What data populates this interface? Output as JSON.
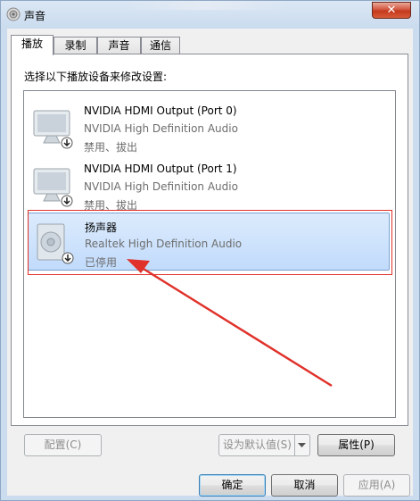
{
  "window": {
    "title": "声音",
    "close_symbol": "✕"
  },
  "tabs": [
    {
      "label": "播放",
      "active": true
    },
    {
      "label": "录制",
      "active": false
    },
    {
      "label": "声音",
      "active": false
    },
    {
      "label": "通信",
      "active": false
    }
  ],
  "prompt": "选择以下播放设备来修改设置:",
  "devices": [
    {
      "name": "NVIDIA HDMI Output (Port 0)",
      "driver": "NVIDIA High Definition Audio",
      "status": "禁用、拔出",
      "icon": "monitor-icon"
    },
    {
      "name": "NVIDIA HDMI Output (Port 1)",
      "driver": "NVIDIA High Definition Audio",
      "status": "禁用、拔出",
      "icon": "monitor-icon"
    },
    {
      "name": "扬声器",
      "driver": "Realtek High Definition Audio",
      "status": "已停用",
      "icon": "speaker-icon",
      "selected": true
    }
  ],
  "buttons": {
    "configure": "配置(C)",
    "set_default": "设为默认值(S)",
    "properties": "属性(P)",
    "ok": "确定",
    "cancel": "取消",
    "apply": "应用(A)"
  },
  "colors": {
    "annotation": "#e0312a",
    "selection": "#c1dbfc"
  }
}
